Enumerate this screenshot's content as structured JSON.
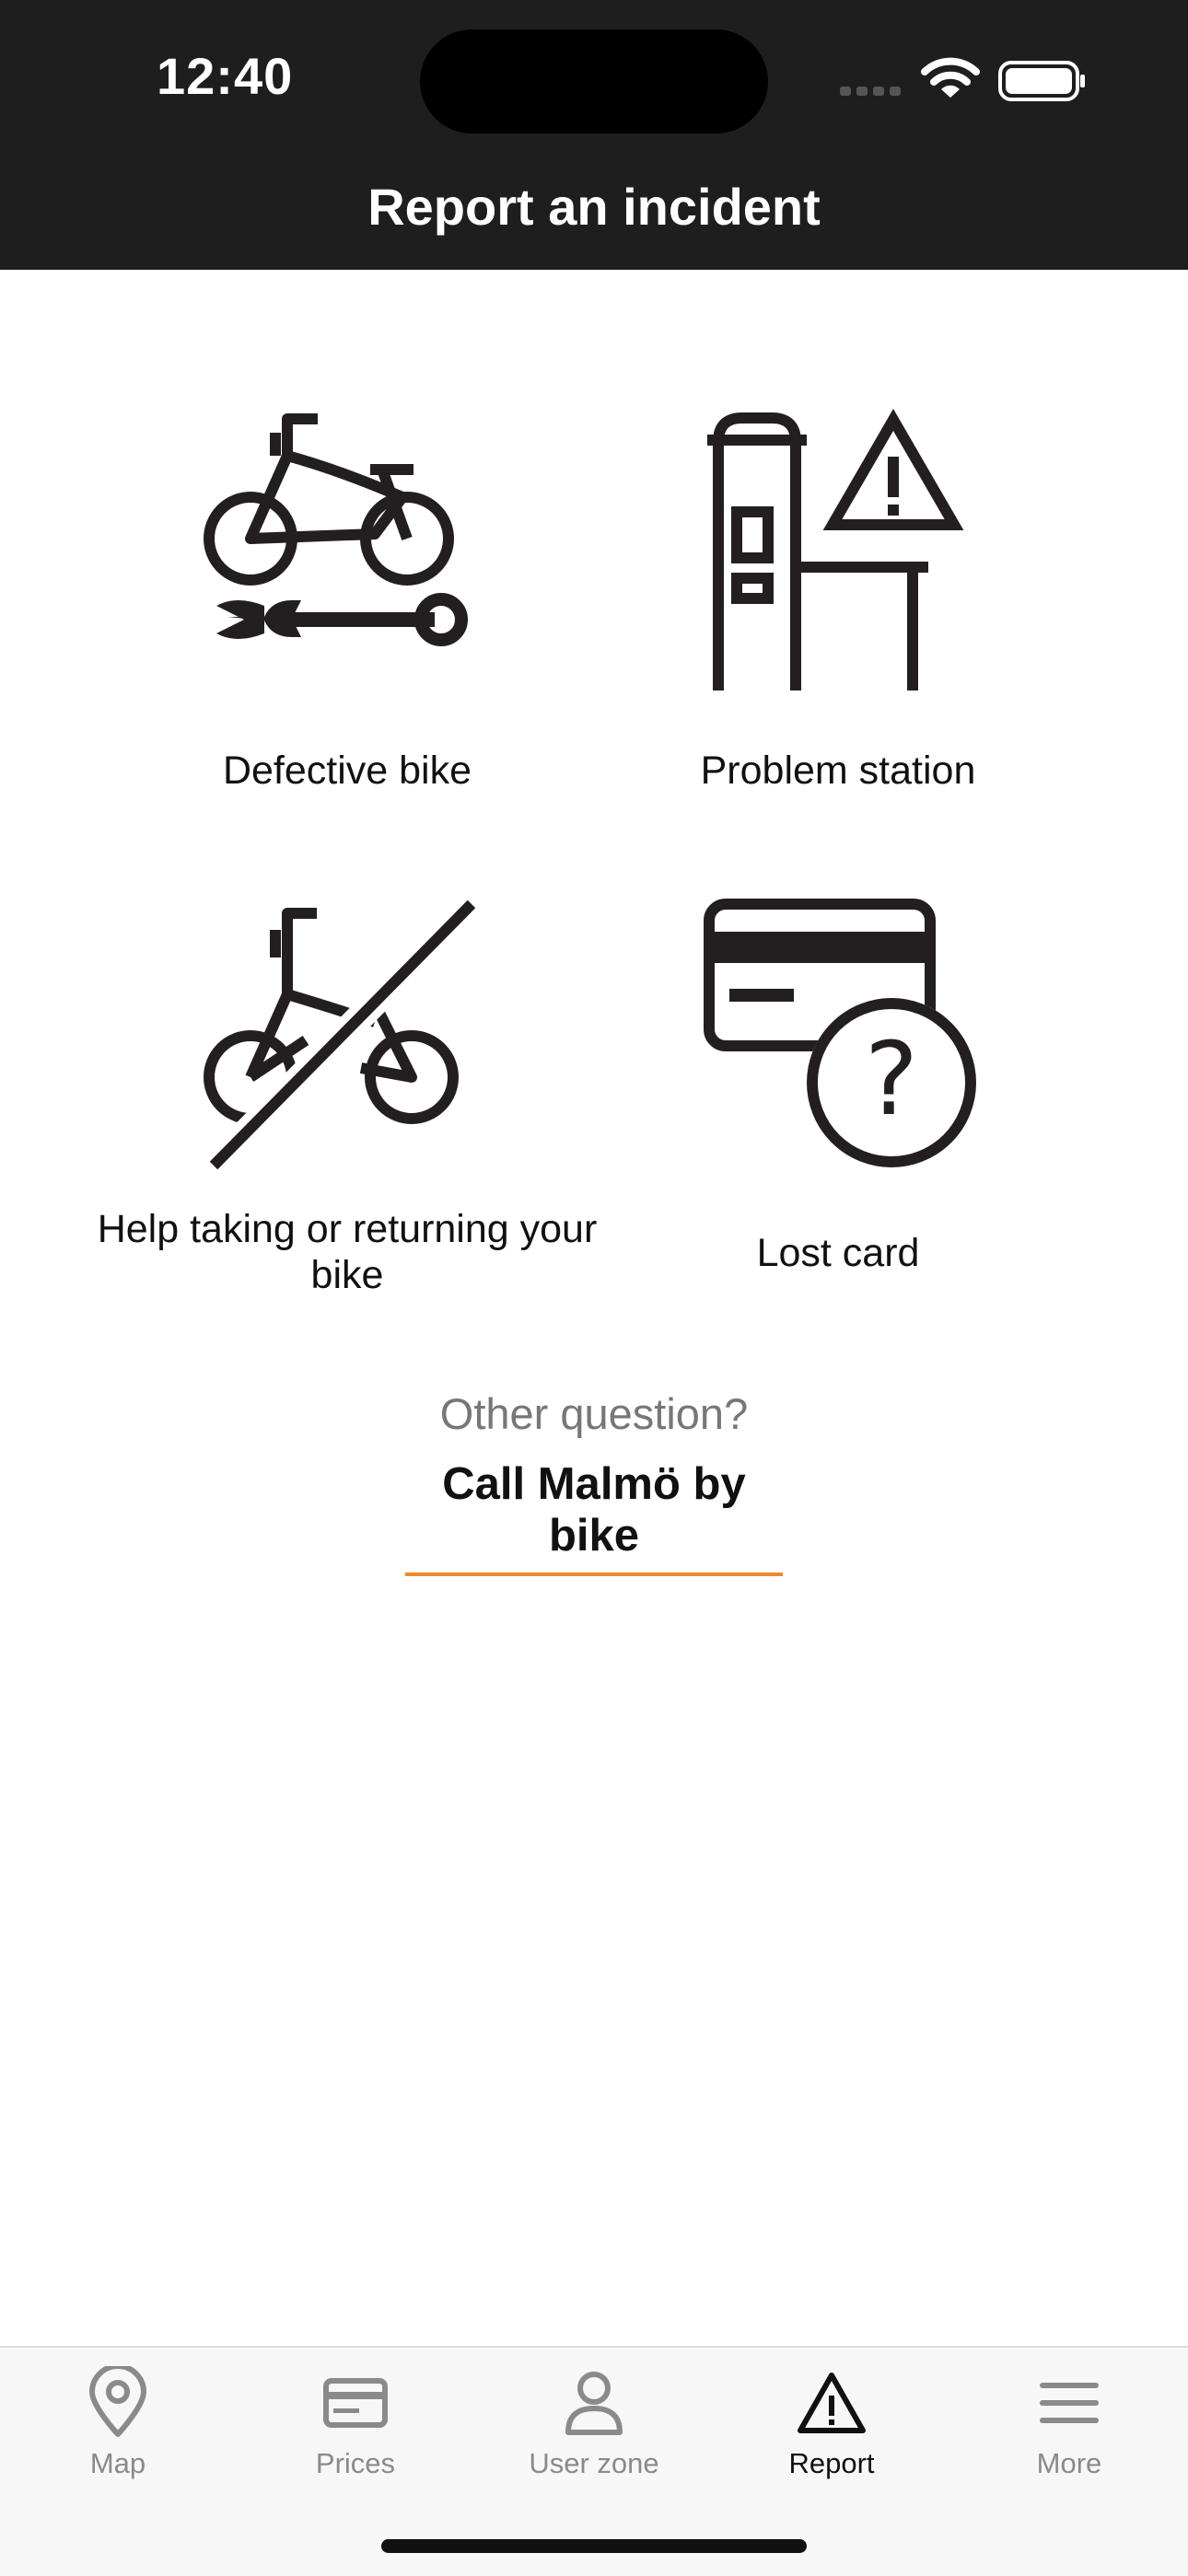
{
  "status_bar": {
    "time": "12:40"
  },
  "header": {
    "title": "Report an incident"
  },
  "incident_options": [
    {
      "label": "Defective bike",
      "icon": "bike-wrench-icon"
    },
    {
      "label": "Problem station",
      "icon": "station-warning-icon"
    },
    {
      "label": "Help taking or returning your bike",
      "icon": "bike-crossed-icon"
    },
    {
      "label": "Lost card",
      "icon": "card-question-icon"
    }
  ],
  "other": {
    "question": "Other question?",
    "call_link": "Call Malmö by bike"
  },
  "tabbar": {
    "tabs": [
      {
        "label": "Map",
        "icon": "map-pin-icon"
      },
      {
        "label": "Prices",
        "icon": "price-card-icon"
      },
      {
        "label": "User zone",
        "icon": "user-icon"
      },
      {
        "label": "Report",
        "icon": "warning-triangle-icon"
      },
      {
        "label": "More",
        "icon": "menu-icon"
      }
    ],
    "active_tab": "Report"
  },
  "colors": {
    "header_bg": "#1e1e1e",
    "accent_underline": "#f0892e",
    "icon_color": "#231f20"
  }
}
